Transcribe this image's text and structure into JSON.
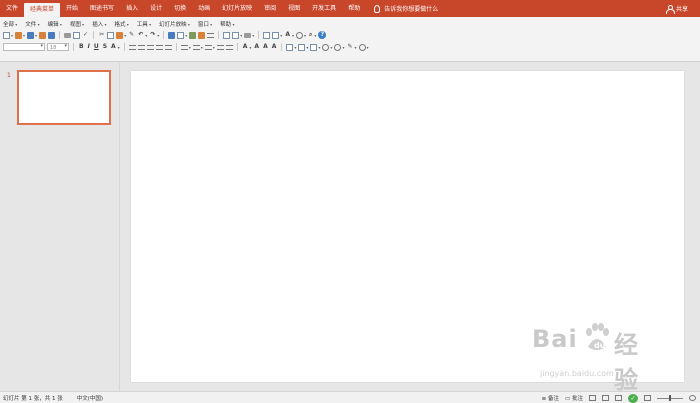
{
  "ribbon": {
    "tabs": [
      {
        "label": "文件",
        "active": false
      },
      {
        "label": "经典菜单",
        "active": true
      },
      {
        "label": "开始",
        "active": false
      },
      {
        "label": "图途书写",
        "active": false
      },
      {
        "label": "插入",
        "active": false
      },
      {
        "label": "设计",
        "active": false
      },
      {
        "label": "切换",
        "active": false
      },
      {
        "label": "动画",
        "active": false
      },
      {
        "label": "幻灯片放映",
        "active": false
      },
      {
        "label": "审阅",
        "active": false
      },
      {
        "label": "视图",
        "active": false
      },
      {
        "label": "开发工具",
        "active": false
      },
      {
        "label": "帮助",
        "active": false
      }
    ],
    "search_hint": "告诉我你想要做什么",
    "share_label": "共享",
    "accent_color": "#c8462a"
  },
  "classic_menu": {
    "items": [
      "全部",
      "文件",
      "编辑",
      "视图",
      "插入",
      "格式",
      "工具",
      "幻灯片放映",
      "窗口",
      "帮助"
    ],
    "font_name": "",
    "font_size": "18"
  },
  "slides_pane": {
    "slide_number": "1"
  },
  "status_bar": {
    "slide_info": "幻灯片 第 1 张，共 1 张",
    "language": "中文(中国)",
    "notes_label": "备注",
    "comments_label": "批注"
  },
  "watermark": {
    "brand": "Bai",
    "brand_suffix": "经验",
    "url": "jingyan.baidu.com"
  }
}
